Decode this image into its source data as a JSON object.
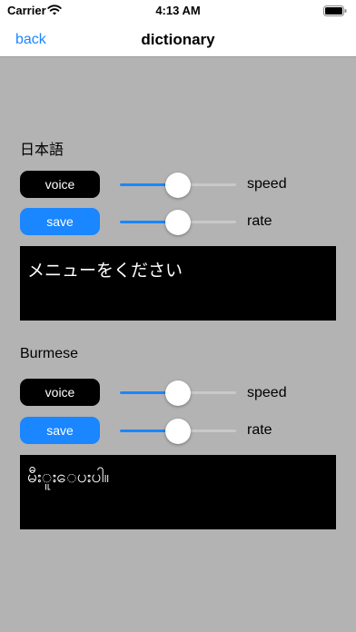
{
  "status_bar": {
    "carrier": "Carrier",
    "time": "4:13 AM"
  },
  "nav": {
    "back": "back",
    "title": "dictionary"
  },
  "sections": [
    {
      "language": "日本語",
      "voice_label": "voice",
      "save_label": "save",
      "speed_label": "speed",
      "rate_label": "rate",
      "speed_value": 0.5,
      "rate_value": 0.5,
      "text": "メニューをください"
    },
    {
      "language": "Burmese",
      "voice_label": "voice",
      "save_label": "save",
      "speed_label": "speed",
      "rate_label": "rate",
      "speed_value": 0.5,
      "rate_value": 0.5,
      "text": "မီးူးေပးပါ။"
    }
  ],
  "colors": {
    "accent": "#1a86ff",
    "background": "#b3b3b3",
    "voice_button": "#000000",
    "text_box": "#000000"
  }
}
